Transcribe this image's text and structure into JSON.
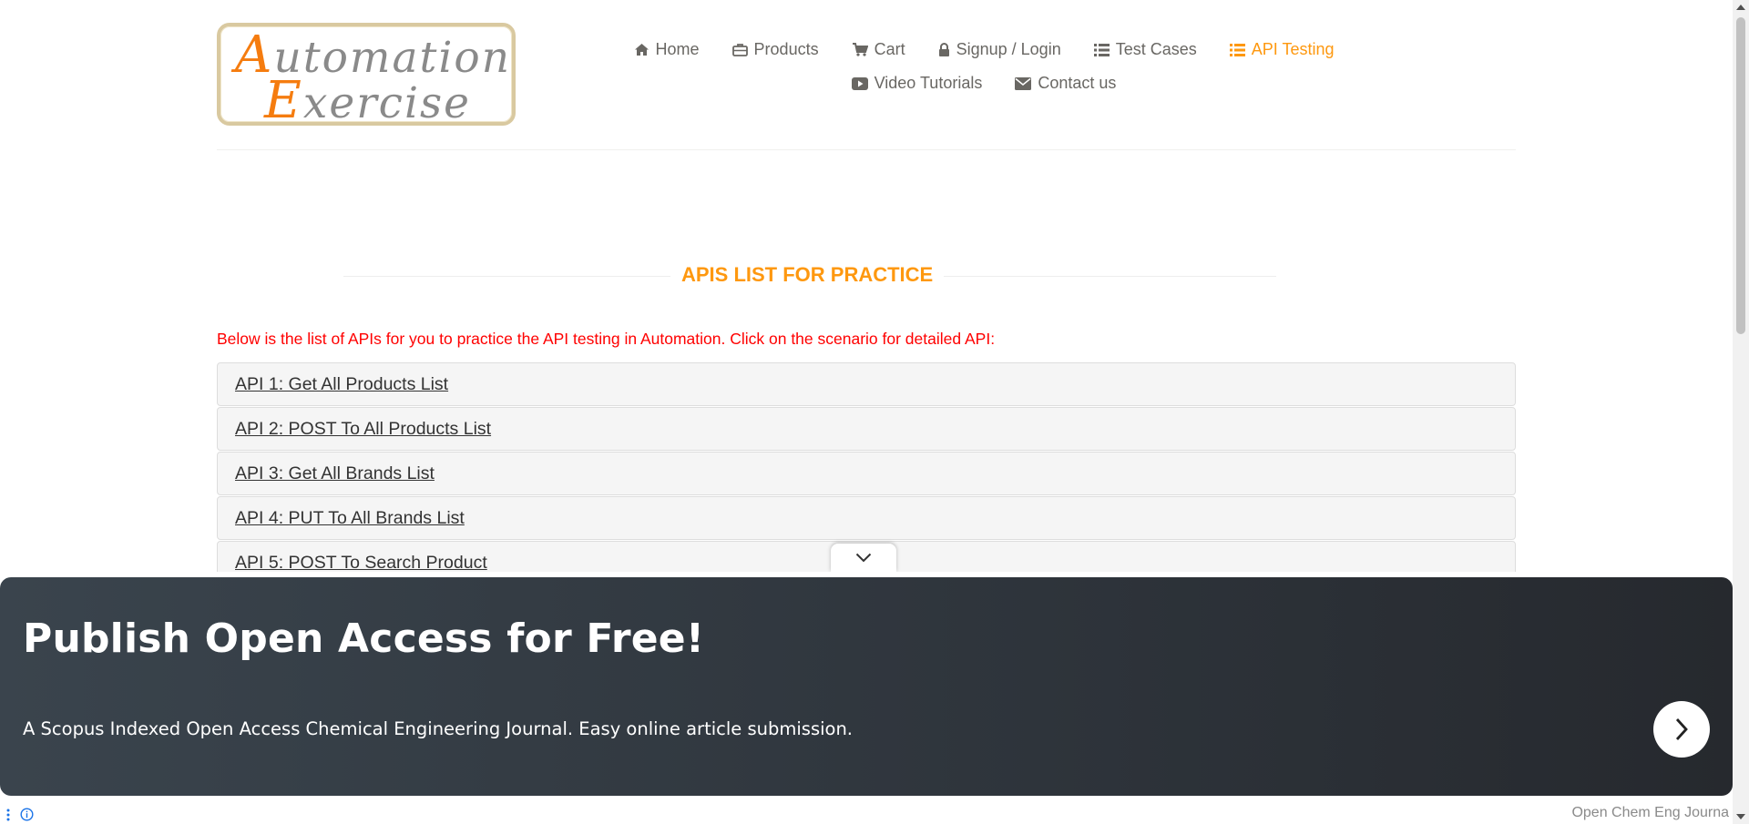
{
  "logo": {
    "line1_cap": "A",
    "line1_rest": "utomation",
    "line2_cap": "E",
    "line2_rest": "xercise"
  },
  "nav": {
    "row1": [
      {
        "label": "Home",
        "icon": "home-icon"
      },
      {
        "label": "Products",
        "icon": "briefcase-icon"
      },
      {
        "label": "Cart",
        "icon": "cart-icon"
      },
      {
        "label": "Signup / Login",
        "icon": "lock-icon"
      },
      {
        "label": "Test Cases",
        "icon": "list-icon"
      },
      {
        "label": "API Testing",
        "icon": "list-icon",
        "active": true
      }
    ],
    "row2": [
      {
        "label": "Video Tutorials",
        "icon": "youtube-icon"
      },
      {
        "label": "Contact us",
        "icon": "envelope-icon"
      }
    ]
  },
  "main": {
    "title": "APIS LIST FOR PRACTICE",
    "intro": "Below is the list of APIs for you to practice the API testing in Automation. Click on the scenario for detailed API:",
    "apis": [
      "API 1: Get All Products List",
      "API 2: POST To All Products List",
      "API 3: Get All Brands List",
      "API 4: PUT To All Brands List",
      "API 5: POST To Search Product"
    ]
  },
  "ad": {
    "title": "Publish Open Access for Free!",
    "text": "A Scopus Indexed Open Access Chemical Engineering Journal. Easy online article submission.",
    "source": "Open Chem Eng Journa"
  },
  "colors": {
    "accent": "#fe980f",
    "intro": "#ff0000",
    "ad_bg": "#2e343b"
  }
}
